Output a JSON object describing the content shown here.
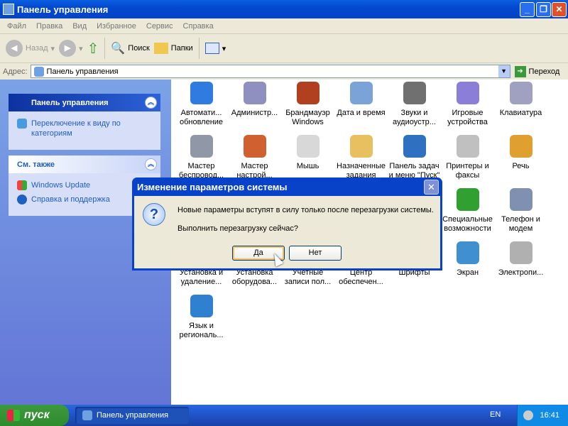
{
  "window": {
    "title": "Панель управления"
  },
  "menu": [
    "Файл",
    "Правка",
    "Вид",
    "Избранное",
    "Сервис",
    "Справка"
  ],
  "toolbar": {
    "back": "Назад",
    "search": "Поиск",
    "folders": "Папки"
  },
  "address": {
    "label": "Адрес:",
    "value": "Панель управления",
    "go": "Переход"
  },
  "sidebar": {
    "main_title": "Панель управления",
    "switch_view": "Переключение к виду по категориям",
    "see_also_title": "См. также",
    "links": [
      "Windows Update",
      "Справка и поддержка"
    ]
  },
  "items": [
    {
      "label": "Автомати... обновление",
      "color": "#2f7be0"
    },
    {
      "label": "Администр...",
      "color": "#8f8fc0"
    },
    {
      "label": "Брандмауэр Windows",
      "color": "#b04020"
    },
    {
      "label": "Дата и время",
      "color": "#7aa4d8"
    },
    {
      "label": "Звуки и аудиоустр...",
      "color": "#707070"
    },
    {
      "label": "Игровые устройства",
      "color": "#8a7ed8"
    },
    {
      "label": "Клавиатура",
      "color": "#a0a0c0"
    },
    {
      "label": "Мастер беспровод...",
      "color": "#9098a8"
    },
    {
      "label": "Мастер настрой...",
      "color": "#d06030"
    },
    {
      "label": "Мышь",
      "color": "#d8d8d8"
    },
    {
      "label": "Назначенные задания",
      "color": "#e8c060"
    },
    {
      "label": "Панель задач и меню \"Пуск\"",
      "color": "#3070c0"
    },
    {
      "label": "Принтеры и факсы",
      "color": "#c0c0c0"
    },
    {
      "label": "Речь",
      "color": "#e0a030"
    },
    {
      "label": "Специальные возможности",
      "color": "#30a030"
    },
    {
      "label": "Телефон и модем",
      "color": "#8090b0"
    },
    {
      "label": "Установка и удаление...",
      "color": "#60a0e0"
    },
    {
      "label": "Установка оборудова...",
      "color": "#7080a0"
    },
    {
      "label": "Учетные записи пол...",
      "color": "#50a050"
    },
    {
      "label": "Центр обеспечен...",
      "color": "#d04040"
    },
    {
      "label": "Шрифты",
      "color": "#e0c060"
    },
    {
      "label": "Экран",
      "color": "#4090d0"
    },
    {
      "label": "Электропи...",
      "color": "#b0b0b0"
    },
    {
      "label": "Язык и региональ...",
      "color": "#2f80d0"
    }
  ],
  "dialog": {
    "title": "Изменение параметров системы",
    "message": "Новые параметры вступят в силу только после перезагрузки системы.",
    "question": "Выполнить перезагрузку сейчас?",
    "yes": "Да",
    "no": "Нет"
  },
  "taskbar": {
    "start": "пуск",
    "task": "Панель управления",
    "lang": "EN",
    "clock": "16:41"
  }
}
